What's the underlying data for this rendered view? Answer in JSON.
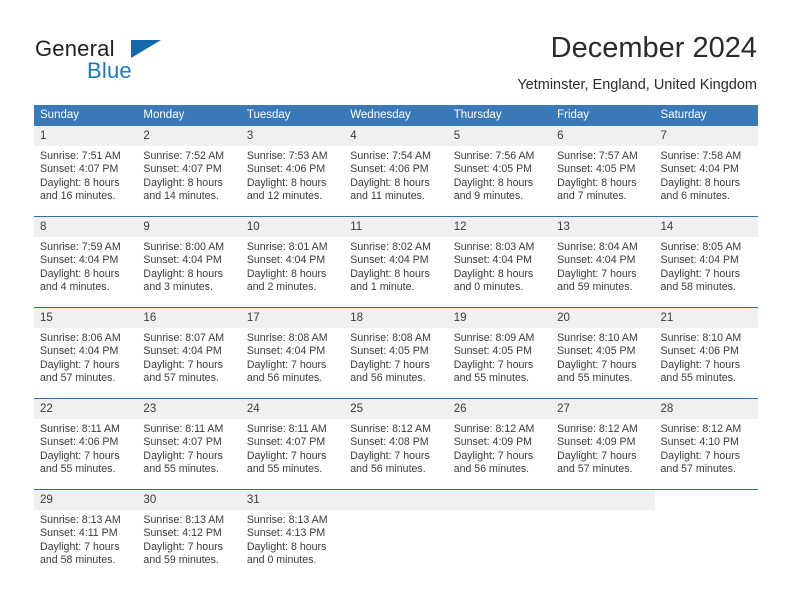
{
  "brand": {
    "word_one": "General",
    "word_two": "Blue",
    "mark": "triangle-logo"
  },
  "header": {
    "title": "December 2024",
    "subtitle": "Yetminster, England, United Kingdom"
  },
  "colors": {
    "header_blue": "#3a79b8",
    "row_divider_blue": "#2f6fb0",
    "daynum_band": "#f0f0f0",
    "brand_blue": "#1c78c0",
    "text": "#3b3b3b"
  },
  "weekday_headers": [
    "Sunday",
    "Monday",
    "Tuesday",
    "Wednesday",
    "Thursday",
    "Friday",
    "Saturday"
  ],
  "weeks": [
    [
      {
        "day": "1",
        "sunrise": "Sunrise: 7:51 AM",
        "sunset": "Sunset: 4:07 PM",
        "daylight_1": "Daylight: 8 hours",
        "daylight_2": "and 16 minutes."
      },
      {
        "day": "2",
        "sunrise": "Sunrise: 7:52 AM",
        "sunset": "Sunset: 4:07 PM",
        "daylight_1": "Daylight: 8 hours",
        "daylight_2": "and 14 minutes."
      },
      {
        "day": "3",
        "sunrise": "Sunrise: 7:53 AM",
        "sunset": "Sunset: 4:06 PM",
        "daylight_1": "Daylight: 8 hours",
        "daylight_2": "and 12 minutes."
      },
      {
        "day": "4",
        "sunrise": "Sunrise: 7:54 AM",
        "sunset": "Sunset: 4:06 PM",
        "daylight_1": "Daylight: 8 hours",
        "daylight_2": "and 11 minutes."
      },
      {
        "day": "5",
        "sunrise": "Sunrise: 7:56 AM",
        "sunset": "Sunset: 4:05 PM",
        "daylight_1": "Daylight: 8 hours",
        "daylight_2": "and 9 minutes."
      },
      {
        "day": "6",
        "sunrise": "Sunrise: 7:57 AM",
        "sunset": "Sunset: 4:05 PM",
        "daylight_1": "Daylight: 8 hours",
        "daylight_2": "and 7 minutes."
      },
      {
        "day": "7",
        "sunrise": "Sunrise: 7:58 AM",
        "sunset": "Sunset: 4:04 PM",
        "daylight_1": "Daylight: 8 hours",
        "daylight_2": "and 6 minutes."
      }
    ],
    [
      {
        "day": "8",
        "sunrise": "Sunrise: 7:59 AM",
        "sunset": "Sunset: 4:04 PM",
        "daylight_1": "Daylight: 8 hours",
        "daylight_2": "and 4 minutes."
      },
      {
        "day": "9",
        "sunrise": "Sunrise: 8:00 AM",
        "sunset": "Sunset: 4:04 PM",
        "daylight_1": "Daylight: 8 hours",
        "daylight_2": "and 3 minutes."
      },
      {
        "day": "10",
        "sunrise": "Sunrise: 8:01 AM",
        "sunset": "Sunset: 4:04 PM",
        "daylight_1": "Daylight: 8 hours",
        "daylight_2": "and 2 minutes."
      },
      {
        "day": "11",
        "sunrise": "Sunrise: 8:02 AM",
        "sunset": "Sunset: 4:04 PM",
        "daylight_1": "Daylight: 8 hours",
        "daylight_2": "and 1 minute."
      },
      {
        "day": "12",
        "sunrise": "Sunrise: 8:03 AM",
        "sunset": "Sunset: 4:04 PM",
        "daylight_1": "Daylight: 8 hours",
        "daylight_2": "and 0 minutes."
      },
      {
        "day": "13",
        "sunrise": "Sunrise: 8:04 AM",
        "sunset": "Sunset: 4:04 PM",
        "daylight_1": "Daylight: 7 hours",
        "daylight_2": "and 59 minutes."
      },
      {
        "day": "14",
        "sunrise": "Sunrise: 8:05 AM",
        "sunset": "Sunset: 4:04 PM",
        "daylight_1": "Daylight: 7 hours",
        "daylight_2": "and 58 minutes."
      }
    ],
    [
      {
        "day": "15",
        "sunrise": "Sunrise: 8:06 AM",
        "sunset": "Sunset: 4:04 PM",
        "daylight_1": "Daylight: 7 hours",
        "daylight_2": "and 57 minutes."
      },
      {
        "day": "16",
        "sunrise": "Sunrise: 8:07 AM",
        "sunset": "Sunset: 4:04 PM",
        "daylight_1": "Daylight: 7 hours",
        "daylight_2": "and 57 minutes."
      },
      {
        "day": "17",
        "sunrise": "Sunrise: 8:08 AM",
        "sunset": "Sunset: 4:04 PM",
        "daylight_1": "Daylight: 7 hours",
        "daylight_2": "and 56 minutes."
      },
      {
        "day": "18",
        "sunrise": "Sunrise: 8:08 AM",
        "sunset": "Sunset: 4:05 PM",
        "daylight_1": "Daylight: 7 hours",
        "daylight_2": "and 56 minutes."
      },
      {
        "day": "19",
        "sunrise": "Sunrise: 8:09 AM",
        "sunset": "Sunset: 4:05 PM",
        "daylight_1": "Daylight: 7 hours",
        "daylight_2": "and 55 minutes."
      },
      {
        "day": "20",
        "sunrise": "Sunrise: 8:10 AM",
        "sunset": "Sunset: 4:05 PM",
        "daylight_1": "Daylight: 7 hours",
        "daylight_2": "and 55 minutes."
      },
      {
        "day": "21",
        "sunrise": "Sunrise: 8:10 AM",
        "sunset": "Sunset: 4:06 PM",
        "daylight_1": "Daylight: 7 hours",
        "daylight_2": "and 55 minutes."
      }
    ],
    [
      {
        "day": "22",
        "sunrise": "Sunrise: 8:11 AM",
        "sunset": "Sunset: 4:06 PM",
        "daylight_1": "Daylight: 7 hours",
        "daylight_2": "and 55 minutes."
      },
      {
        "day": "23",
        "sunrise": "Sunrise: 8:11 AM",
        "sunset": "Sunset: 4:07 PM",
        "daylight_1": "Daylight: 7 hours",
        "daylight_2": "and 55 minutes."
      },
      {
        "day": "24",
        "sunrise": "Sunrise: 8:11 AM",
        "sunset": "Sunset: 4:07 PM",
        "daylight_1": "Daylight: 7 hours",
        "daylight_2": "and 55 minutes."
      },
      {
        "day": "25",
        "sunrise": "Sunrise: 8:12 AM",
        "sunset": "Sunset: 4:08 PM",
        "daylight_1": "Daylight: 7 hours",
        "daylight_2": "and 56 minutes."
      },
      {
        "day": "26",
        "sunrise": "Sunrise: 8:12 AM",
        "sunset": "Sunset: 4:09 PM",
        "daylight_1": "Daylight: 7 hours",
        "daylight_2": "and 56 minutes."
      },
      {
        "day": "27",
        "sunrise": "Sunrise: 8:12 AM",
        "sunset": "Sunset: 4:09 PM",
        "daylight_1": "Daylight: 7 hours",
        "daylight_2": "and 57 minutes."
      },
      {
        "day": "28",
        "sunrise": "Sunrise: 8:12 AM",
        "sunset": "Sunset: 4:10 PM",
        "daylight_1": "Daylight: 7 hours",
        "daylight_2": "and 57 minutes."
      }
    ],
    [
      {
        "day": "29",
        "sunrise": "Sunrise: 8:13 AM",
        "sunset": "Sunset: 4:11 PM",
        "daylight_1": "Daylight: 7 hours",
        "daylight_2": "and 58 minutes."
      },
      {
        "day": "30",
        "sunrise": "Sunrise: 8:13 AM",
        "sunset": "Sunset: 4:12 PM",
        "daylight_1": "Daylight: 7 hours",
        "daylight_2": "and 59 minutes."
      },
      {
        "day": "31",
        "sunrise": "Sunrise: 8:13 AM",
        "sunset": "Sunset: 4:13 PM",
        "daylight_1": "Daylight: 8 hours",
        "daylight_2": "and 0 minutes."
      },
      {
        "day": "",
        "sunrise": "",
        "sunset": "",
        "daylight_1": "",
        "daylight_2": ""
      },
      {
        "day": "",
        "sunrise": "",
        "sunset": "",
        "daylight_1": "",
        "daylight_2": ""
      },
      {
        "day": "",
        "sunrise": "",
        "sunset": "",
        "daylight_1": "",
        "daylight_2": ""
      },
      {
        "day": "",
        "sunrise": "",
        "sunset": "",
        "daylight_1": "",
        "daylight_2": ""
      }
    ]
  ]
}
